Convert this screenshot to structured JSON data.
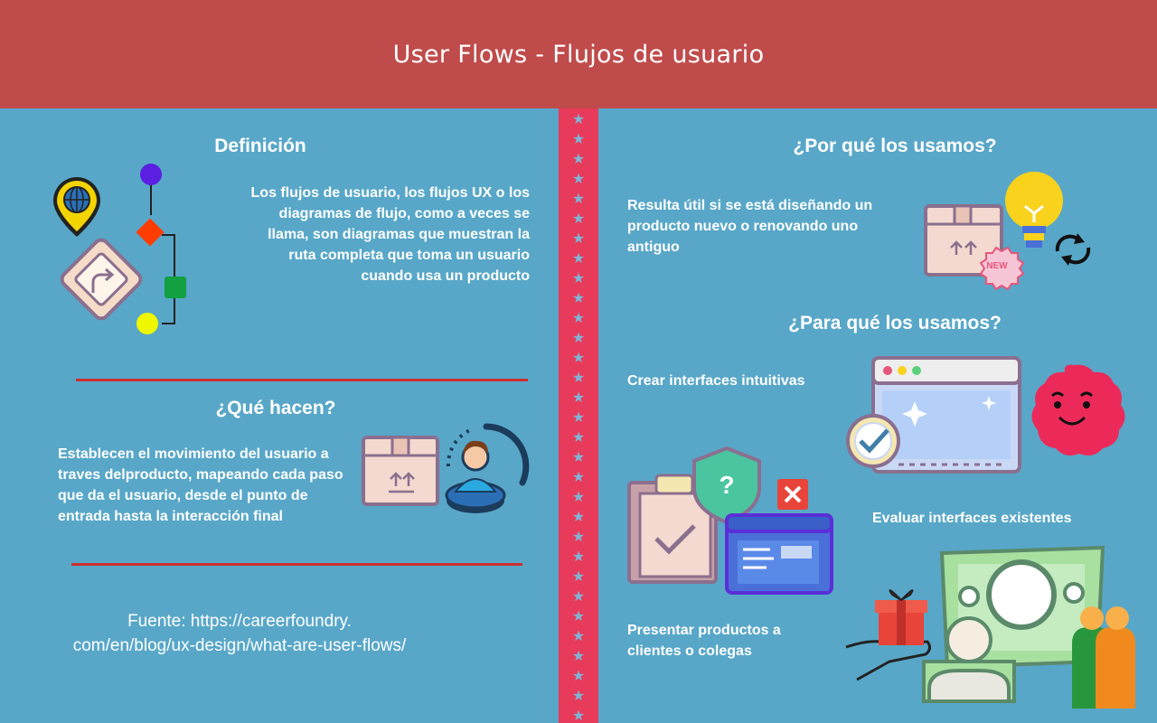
{
  "header": {
    "title": "User Flows - Flujos de usuario"
  },
  "left": {
    "definition": {
      "title": "Definición",
      "text": "Los flujos de usuario, los flujos UX o los diagramas de flujo, como a veces se llama, son diagramas que muestran la ruta completa que toma un usuario cuando usa un producto"
    },
    "what": {
      "title": "¿Qué hacen?",
      "text": "Establecen el movimiento del usuario a traves delproducto, mapeando cada paso que da el usuario, desde el punto de entrada hasta la interacción final"
    },
    "source": {
      "line1": "Fuente: https://careerfoundry.",
      "line2": "com/en/blog/ux-design/what-are-user-flows/"
    }
  },
  "right": {
    "why": {
      "title": "¿Por qué los usamos?",
      "text": "Resulta útil si se está diseñando un producto nuevo o renovando uno antiguo",
      "badge": "NEW"
    },
    "what_for": {
      "title": "¿Para qué los usamos?",
      "item1": "Crear interfaces intuitivas",
      "item2": "Evaluar interfaces existentes",
      "item3": "Presentar productos a clientes o colegas"
    }
  },
  "colors": {
    "header": "#c04b4b",
    "background": "#58a7c8",
    "stripe": "#e83a5a",
    "rule": "#cc2f2f"
  }
}
